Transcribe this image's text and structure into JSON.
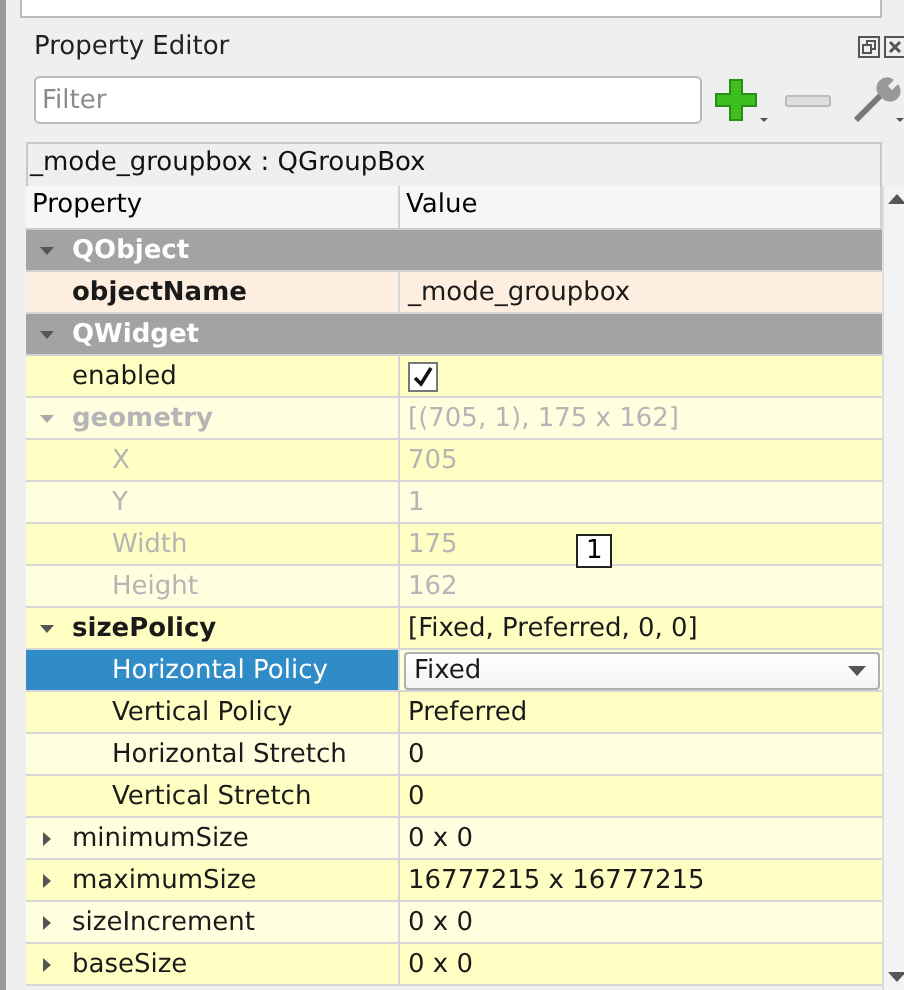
{
  "window": {
    "title": "Property Editor"
  },
  "filter": {
    "placeholder": "Filter"
  },
  "object_label": "_mode_groupbox : QGroupBox",
  "table": {
    "columns": [
      "Property",
      "Value"
    ],
    "sections": [
      {
        "name": "QObject",
        "expanded": true,
        "color": "#fdeedf",
        "rows": [
          {
            "name": "objectName",
            "value": "_mode_groupbox",
            "kind": "text",
            "bold": true,
            "disabled": false,
            "selected": false
          }
        ]
      },
      {
        "name": "QWidget",
        "expanded": true,
        "color": "#ffffe0",
        "rows": [
          {
            "name": "enabled",
            "kind": "checkbox",
            "checked": true,
            "bold": false,
            "disabled": false,
            "selected": false
          },
          {
            "name": "geometry",
            "value": "[(705, 1), 175 x 162]",
            "kind": "text",
            "bold": true,
            "disabled": true,
            "selected": false,
            "expanded": true,
            "children": [
              {
                "name": "X",
                "value": "705",
                "kind": "text",
                "bold": false,
                "disabled": true,
                "selected": false
              },
              {
                "name": "Y",
                "value": "1",
                "kind": "text",
                "bold": false,
                "disabled": true,
                "selected": false
              },
              {
                "name": "Width",
                "value": "175",
                "kind": "text",
                "bold": false,
                "disabled": true,
                "selected": false
              },
              {
                "name": "Height",
                "value": "162",
                "kind": "text",
                "bold": false,
                "disabled": true,
                "selected": false
              }
            ]
          },
          {
            "name": "sizePolicy",
            "value": "[Fixed, Preferred, 0, 0]",
            "kind": "text",
            "bold": true,
            "disabled": false,
            "selected": false,
            "expanded": true,
            "children": [
              {
                "name": "Horizontal Policy",
                "value": "Fixed",
                "kind": "combo",
                "bold": false,
                "disabled": false,
                "selected": true
              },
              {
                "name": "Vertical Policy",
                "value": "Preferred",
                "kind": "text",
                "bold": false,
                "disabled": false,
                "selected": false
              },
              {
                "name": "Horizontal Stretch",
                "value": "0",
                "kind": "text",
                "bold": false,
                "disabled": false,
                "selected": false
              },
              {
                "name": "Vertical Stretch",
                "value": "0",
                "kind": "text",
                "bold": false,
                "disabled": false,
                "selected": false
              }
            ]
          },
          {
            "name": "minimumSize",
            "value": "0 x 0",
            "kind": "text",
            "bold": false,
            "disabled": false,
            "selected": false,
            "expanded": false
          },
          {
            "name": "maximumSize",
            "value": "16777215 x 16777215",
            "kind": "text",
            "bold": false,
            "disabled": false,
            "selected": false,
            "expanded": false
          },
          {
            "name": "sizeIncrement",
            "value": "0 x 0",
            "kind": "text",
            "bold": false,
            "disabled": false,
            "selected": false,
            "expanded": false
          },
          {
            "name": "baseSize",
            "value": "0 x 0",
            "kind": "text",
            "bold": false,
            "disabled": false,
            "selected": false,
            "expanded": false
          }
        ]
      }
    ]
  },
  "badge": "1"
}
